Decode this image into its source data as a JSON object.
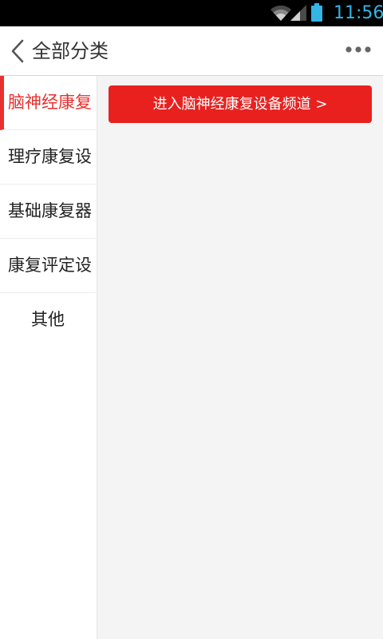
{
  "status_bar": {
    "time": "11:56",
    "icons": [
      "wifi-icon",
      "signal-icon",
      "battery-icon"
    ],
    "accent_color": "#33b5e5"
  },
  "header": {
    "title": "全部分类",
    "back_icon": "chevron-left-icon",
    "more_icon": "more-dots-icon"
  },
  "sidebar": {
    "items": [
      {
        "label": "脑神经康复",
        "active": true
      },
      {
        "label": "理疗康复设",
        "active": false
      },
      {
        "label": "基础康复器",
        "active": false
      },
      {
        "label": "康复评定设",
        "active": false
      },
      {
        "label": "其他",
        "active": false
      }
    ]
  },
  "content": {
    "channel_button_label": "进入脑神经康复设备频道 >"
  },
  "colors": {
    "brand_red": "#e8211f",
    "active_text": "#e8312f",
    "content_bg": "#f4f4f4"
  }
}
